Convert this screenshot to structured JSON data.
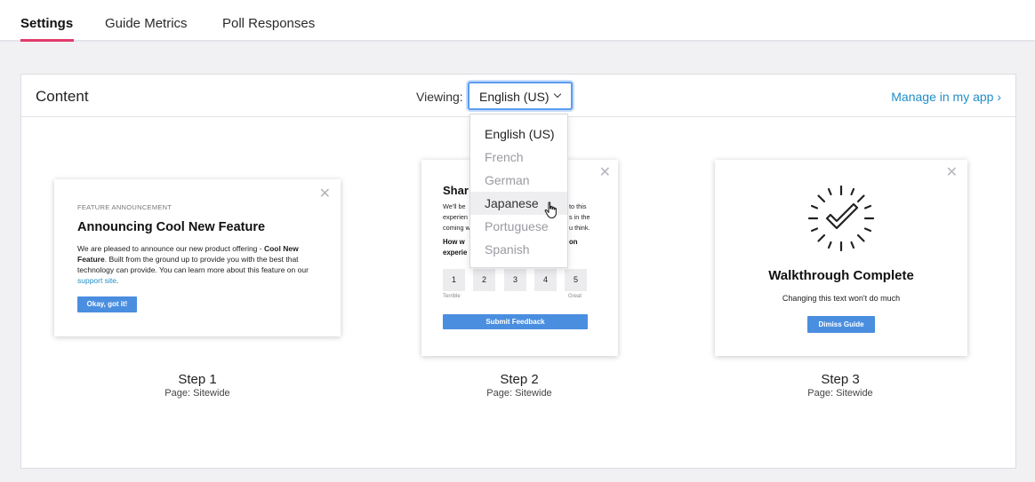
{
  "tabs": [
    {
      "label": "Settings",
      "active": true
    },
    {
      "label": "Guide Metrics",
      "active": false
    },
    {
      "label": "Poll Responses",
      "active": false
    }
  ],
  "panel": {
    "title": "Content",
    "viewing_label": "Viewing:",
    "selected_language": "English (US)",
    "manage_link": "Manage in my app ›"
  },
  "dropdown": {
    "options": [
      "English (US)",
      "French",
      "German",
      "Japanese",
      "Portuguese",
      "Spanish"
    ],
    "selected": "English (US)",
    "hovered": "Japanese"
  },
  "cards": {
    "step1": {
      "kicker": "FEATURE ANNOUNCEMENT",
      "title": "Announcing Cool New Feature",
      "body_1": "We are pleased to announce our new product offering - ",
      "body_bold": "Cool New Feature",
      "body_2": ". Built from the ground up to provide you with the best that technology can provide. You can learn more about this feature on our ",
      "body_link": "support site",
      "body_3": ".",
      "button": "Okay, got it!"
    },
    "step2": {
      "title_visible": "Shar",
      "line1_left": "We'll be",
      "line1_right": "to this",
      "line2_left": "experien",
      "line2_right": "s in the",
      "line3_left": "coming w",
      "line3_right": "u think.",
      "q1_left": "How w",
      "q1_right": "on",
      "q2_left": "experie",
      "ratings": [
        "1",
        "2",
        "3",
        "4",
        "5"
      ],
      "low_label": "Terrible",
      "high_label": "Great",
      "button": "Submit Feedback"
    },
    "step3": {
      "title": "Walkthrough Complete",
      "subtitle": "Changing this text won't do much",
      "button": "Dimiss Guide"
    }
  },
  "steps": [
    {
      "title": "Step 1",
      "page": "Page: Sitewide"
    },
    {
      "title": "Step 2",
      "page": "Page: Sitewide"
    },
    {
      "title": "Step 3",
      "page": "Page: Sitewide"
    }
  ],
  "colors": {
    "accent_tab": "#e23a6b",
    "link": "#1f8ec9",
    "button": "#4a8ee0",
    "focus_ring": "#5b9cf0"
  }
}
